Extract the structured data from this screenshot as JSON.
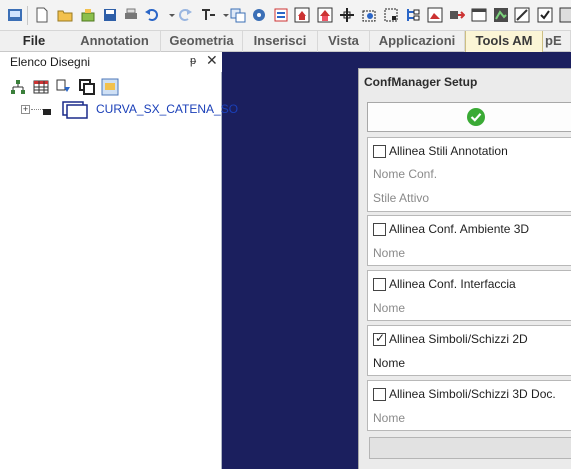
{
  "toolbar": {
    "icons": [
      "app-menu-icon",
      "new-icon",
      "open-icon",
      "open-recent-icon",
      "save-icon",
      "print-icon",
      "undo-icon",
      "redo-icon",
      "tool-icon",
      "copy-icon",
      "settings-icon",
      "layer-icon",
      "home-icon",
      "snap-icon",
      "target-icon",
      "frame-icon",
      "grid-icon",
      "image-icon",
      "arrow-icon",
      "window-icon",
      "zoom-icon",
      "check-icon"
    ]
  },
  "ribbon": {
    "tabs": [
      {
        "label": "File"
      },
      {
        "label": "Annotation"
      },
      {
        "label": "Geometria"
      },
      {
        "label": "Inserisci"
      },
      {
        "label": "Vista"
      },
      {
        "label": "Applicazioni"
      },
      {
        "label": "Tools AM"
      },
      {
        "label": "pE"
      }
    ],
    "active_tab": "Tools AM"
  },
  "panel": {
    "title": "Elenco Disegni",
    "pin": "ᵽ",
    "close": "✕",
    "tree": {
      "expander": "+",
      "item_label": "CURVA_SX_CATENA_SO"
    }
  },
  "dialog": {
    "title": "ConfManager Setup",
    "groups": [
      {
        "label": "Allinea Stili Annotation",
        "checked": false,
        "fields": [
          "Nome Conf.",
          "Stile Attivo"
        ]
      },
      {
        "label": "Allinea Conf. Ambiente 3D",
        "checked": false,
        "fields": [
          "Nome"
        ]
      },
      {
        "label": "Allinea Conf. Interfaccia",
        "checked": false,
        "fields": [
          "Nome"
        ]
      },
      {
        "label": "Allinea Simboli/Schizzi 2D",
        "checked": true,
        "fields": [
          "Nome"
        ]
      },
      {
        "label": "Allinea Simboli/Schizzi 3D Doc.",
        "checked": false,
        "fields": [
          "Nome"
        ]
      }
    ]
  },
  "colors": {
    "canvas_background": "#1b1f5e",
    "ok_icon": "#3aaa35",
    "tree_item_text": "#1a3fb8",
    "active_tab": "#fbf5d6"
  }
}
